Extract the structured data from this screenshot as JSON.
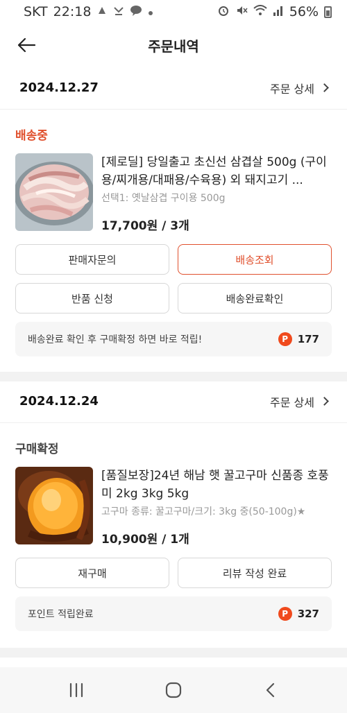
{
  "status_bar": {
    "carrier": "SKT",
    "time": "22:18",
    "battery": "56%"
  },
  "header": {
    "title": "주문내역"
  },
  "orders": [
    {
      "date": "2024.12.27",
      "detail_label": "주문 상세",
      "status": "배송중",
      "status_color": "#e0502d",
      "product_name": "[제로딜] 당일출고 초신선 삼겹살 500g (구이용/찌개용/대패용/수육용) 외 돼지고기 ...",
      "option": "선택1: 옛날삼겹 구이용 500g",
      "price": "17,700원 / 3개",
      "buttons": [
        "판매자문의",
        "배송조회",
        "반품 신청",
        "배송완료확인"
      ],
      "point_text": "배송완료 확인 후 구매확정 하면 바로 적립!",
      "point_value": "177",
      "point_badge": "P"
    },
    {
      "date": "2024.12.24",
      "detail_label": "주문 상세",
      "status": "구매확정",
      "status_color": "#444444",
      "product_name": "[품질보장]24년 해남 햇 꿀고구마 신품종 호풍미 2kg 3kg 5kg",
      "option": "고구마 종류: 꿀고구마/크기: 3kg 중(50-100g)★",
      "price": "10,900원 / 1개",
      "buttons": [
        "재구매",
        "리뷰 작성 완료"
      ],
      "point_text": "포인트 적립완료",
      "point_value": "327",
      "point_badge": "P"
    }
  ],
  "accent_color": "#e0502d"
}
